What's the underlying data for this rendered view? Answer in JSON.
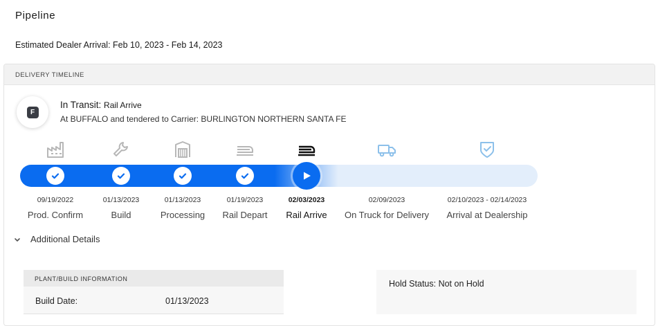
{
  "page": {
    "title": "Pipeline",
    "eta_label": "Estimated Dealer Arrival: Feb 10, 2023 - Feb 14, 2023"
  },
  "timeline": {
    "header": "DELIVERY TIMELINE",
    "avatar_letter": "F",
    "status_label": "In Transit:",
    "status_value": "Rail Arrive",
    "status_detail": "At BUFFALO and tendered to Carrier: BURLINGTON NORTHERN SANTA FE",
    "steps": [
      {
        "label": "Prod. Confirm",
        "date": "09/19/2022",
        "state": "done",
        "icon": "factory-icon"
      },
      {
        "label": "Build",
        "date": "01/13/2023",
        "state": "done",
        "icon": "wrench-icon"
      },
      {
        "label": "Processing",
        "date": "01/13/2023",
        "state": "done",
        "icon": "processing-icon"
      },
      {
        "label": "Rail Depart",
        "date": "01/19/2023",
        "state": "done",
        "icon": "rail-depart-icon"
      },
      {
        "label": "Rail Arrive",
        "date": "02/03/2023",
        "state": "current",
        "icon": "rail-arrive-icon"
      },
      {
        "label": "On Truck for Delivery",
        "date": "02/09/2023",
        "state": "upcoming",
        "icon": "truck-icon"
      },
      {
        "label": "Arrival at Dealership",
        "date": "02/10/2023 - 02/14/2023",
        "state": "upcoming",
        "icon": "shield-check-icon"
      }
    ],
    "colors": {
      "progress": "#0a6cf0",
      "track": "#e3eefb",
      "done_icon": "#b7b7b7",
      "upcoming_icon": "#8cc0ea"
    }
  },
  "additional": {
    "toggle_label": "Additional Details",
    "plant": {
      "header": "PLANT/BUILD INFORMATION",
      "build_date_label": "Build Date:",
      "build_date_value": "01/13/2023"
    },
    "hold_status": "Hold Status: Not on Hold"
  }
}
